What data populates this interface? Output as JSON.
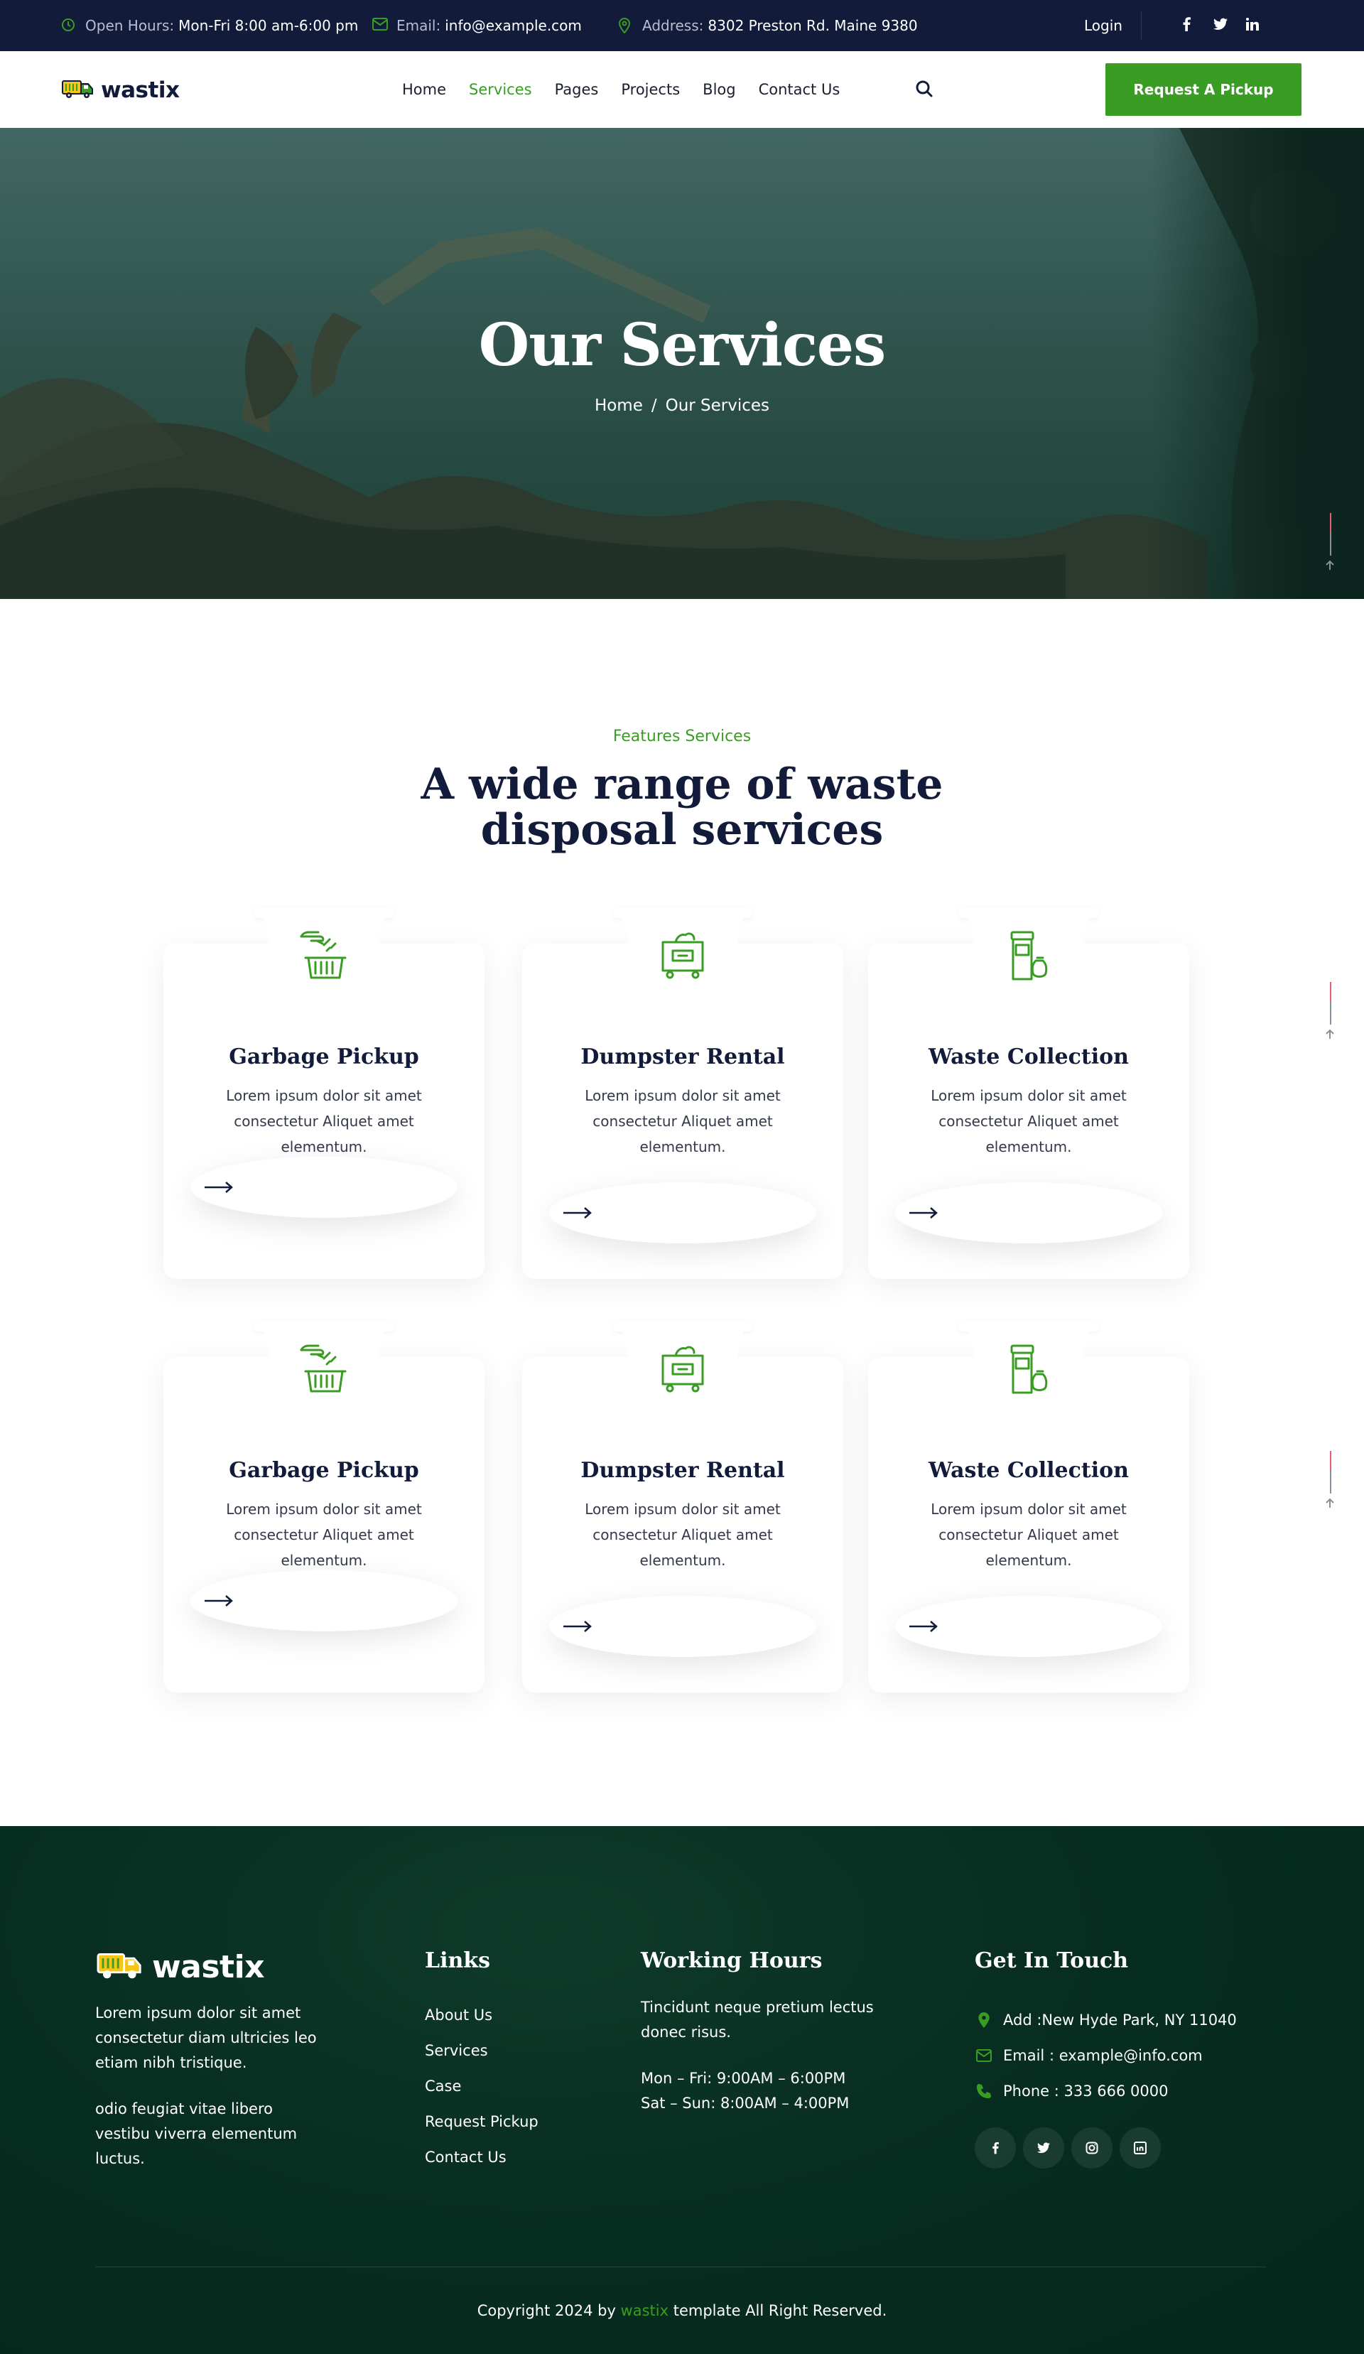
{
  "topbar": {
    "hours_label": "Open Hours:",
    "hours_value": "Mon-Fri 8:00 am-6:00 pm",
    "email_label": "Email:",
    "email_value": "info@example.com",
    "address_label": "Address:",
    "address_value": "8302 Preston Rd. Maine 9380",
    "login": "Login",
    "social_icons": [
      "facebook-icon",
      "twitter-icon",
      "linkedin-icon"
    ]
  },
  "brand": {
    "name": "wastix",
    "accent_color": "#3a9d23",
    "navy_color": "#121b3a"
  },
  "nav": {
    "items": [
      {
        "label": "Home",
        "active": false
      },
      {
        "label": "Services",
        "active": true
      },
      {
        "label": "Pages",
        "active": false
      },
      {
        "label": "Projects",
        "active": false
      },
      {
        "label": "Blog",
        "active": false
      },
      {
        "label": "Contact Us",
        "active": false
      }
    ],
    "cta_label": "Request A Pickup"
  },
  "hero": {
    "title": "Our Services",
    "breadcrumb_home": "Home",
    "breadcrumb_sep": "/",
    "breadcrumb_current": "Our Services"
  },
  "services": {
    "subtitle": "Features Services",
    "title": "A wide range of waste disposal services",
    "cards": [
      {
        "title": "Garbage Pickup",
        "text": "Lorem ipsum dolor sit amet consectetur Aliquet amet elementum.",
        "icon": "garbage-pickup-icon"
      },
      {
        "title": "Dumpster Rental",
        "text": "Lorem ipsum dolor sit amet consectetur Aliquet amet elementum.",
        "icon": "dumpster-icon"
      },
      {
        "title": "Waste Collection",
        "text": "Lorem ipsum dolor sit amet consectetur Aliquet amet elementum.",
        "icon": "waste-bin-icon"
      },
      {
        "title": "Garbage Pickup",
        "text": "Lorem ipsum dolor sit amet consectetur Aliquet amet elementum.",
        "icon": "garbage-pickup-icon"
      },
      {
        "title": "Dumpster Rental",
        "text": "Lorem ipsum dolor sit amet consectetur Aliquet amet elementum.",
        "icon": "dumpster-icon"
      },
      {
        "title": "Waste Collection",
        "text": "Lorem ipsum dolor sit amet consectetur Aliquet amet elementum.",
        "icon": "waste-bin-icon"
      }
    ]
  },
  "footer": {
    "about_1": "Lorem ipsum dolor sit amet consectetur diam ultricies leo etiam nibh tristique.",
    "about_2": "odio feugiat vitae libero vestibu viverra elementum luctus.",
    "links_title": "Links",
    "links": [
      "About Us",
      "Services",
      "Case",
      "Request Pickup",
      "Contact Us"
    ],
    "hours_title": "Working Hours",
    "hours_text": "Tincidunt neque pretium lectus donec risus.",
    "hours_weekday": "Mon – Fri: 9:00AM – 6:00PM",
    "hours_weekend": "Sat – Sun: 8:00AM – 4:00PM",
    "contact_title": "Get In Touch",
    "contact": [
      {
        "icon": "location-pin-icon",
        "text": "Add :New Hyde Park, NY 11040"
      },
      {
        "icon": "email-icon",
        "text": "Email : example@info.com"
      },
      {
        "icon": "phone-icon",
        "text": "Phone : 333 666 0000"
      }
    ],
    "social_icons": [
      "facebook-icon",
      "twitter-icon",
      "instagram-icon",
      "linkedin-icon"
    ],
    "copyright_pre": "Copyright 2024 by ",
    "copyright_brand": "wastix",
    "copyright_post": " template All Right Reserved."
  }
}
